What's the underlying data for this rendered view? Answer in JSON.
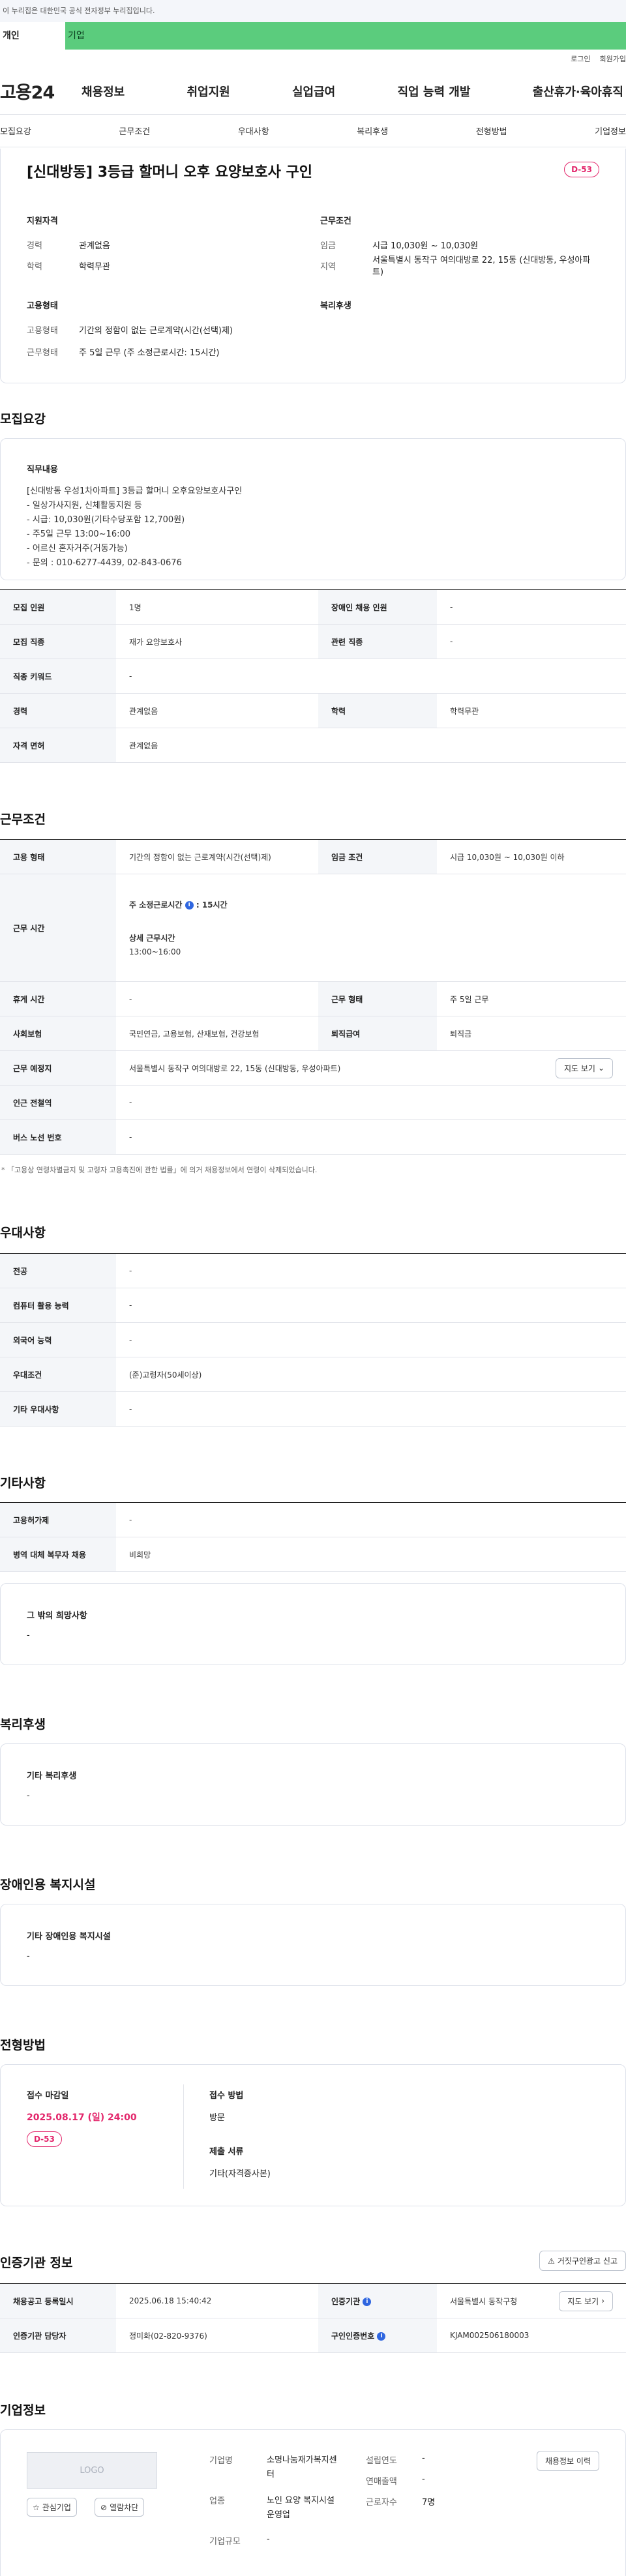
{
  "notice": "이 누리집은 대한민국 공식 전자정부 누리집입니다.",
  "tabs": {
    "personal": "개인",
    "company": "기업"
  },
  "util": {
    "login": "로그인",
    "join": "회원가입"
  },
  "logo": "고용24",
  "gnb": [
    "채용정보",
    "취업지원",
    "실업급여",
    "직업 능력 개발",
    "출산휴가·육아휴직"
  ],
  "subnav": [
    "모집요강",
    "근무조건",
    "우대사항",
    "복리후생",
    "전형방법",
    "기업정보"
  ],
  "summary": {
    "title": "[신대방동] 3등급 할머니 오후 요양보호사 구인",
    "dday": "D-53",
    "qual_title": "지원자격",
    "cond_title": "근무조건",
    "emp_title": "고용형태",
    "welfare_title": "복리후생",
    "career_k": "경력",
    "career_v": "관계없음",
    "edu_k": "학력",
    "edu_v": "학력무관",
    "wage_k": "임금",
    "wage_v": "시급 10,030원 ~ 10,030원",
    "region_k": "지역",
    "region_v": "서울특별시 동작구 여의대방로 22, 15동 (신대방동, 우성아파트)",
    "emptype_k": "고용형태",
    "emptype_v": "기간의 정함이 없는 근로계약(시간(선택)제)",
    "workshape_k": "근무형태",
    "workshape_v": "주 5일 근무 (주 소정근로시간: 15시간)"
  },
  "recruit": {
    "section": "모집요강",
    "job_title": "직무내용",
    "job_lines": [
      "[신대방동 우성1차아파트] 3등급 할머니 오후요양보호사구인",
      "- 일상가사지원, 신체활동지원 등",
      "- 시급: 10,030원(기타수당포함 12,700원)",
      "- 주5일 근무 13:00~16:00",
      "- 어르신 혼자거주(거동가능)",
      "- 문의 : 010-6277-4439, 02-843-0676"
    ],
    "rows": [
      [
        "모집 인원",
        "1명",
        "장애인 채용 인원",
        "-"
      ],
      [
        "모집 직종",
        "재가 요양보호사",
        "관련 직종",
        "-"
      ],
      [
        "직종 키워드",
        "-"
      ],
      [
        "경력",
        "관계없음",
        "학력",
        "학력무관"
      ],
      [
        "자격 면허",
        "관계없음"
      ]
    ]
  },
  "work": {
    "section": "근무조건",
    "emptype_k": "고용 형태",
    "emptype_v": "기간의 정함이 없는 근로계약(시간(선택)제)",
    "wage_k": "임금 조건",
    "wage_v": "시급 10,030원 ~ 10,030원 이하",
    "hours_k": "근무 시간",
    "hours_weekly_label": "주 소정근로시간",
    "hours_weekly_value": ": 15시간",
    "hours_detail_label": "상세 근무시간",
    "hours_detail_value": "13:00~16:00",
    "rest_k": "휴게 시간",
    "rest_v": "-",
    "shape_k": "근무 형태",
    "shape_v": "주 5일 근무",
    "insurance_k": "사회보험",
    "insurance_v": "국민연금, 고용보험, 산재보험, 건강보험",
    "retire_k": "퇴직급여",
    "retire_v": "퇴직금",
    "place_k": "근무 예정지",
    "place_v": "서울특별시 동작구 여의대방로 22, 15동 (신대방동, 우성아파트)",
    "map_btn": "지도 보기",
    "subway_k": "인근 전철역",
    "subway_v": "-",
    "bus_k": "버스 노선 번호",
    "bus_v": "-",
    "note": "* 「고용상 연령차별금지 및 고령자 고용촉진에 관한 법률」에 의거 채용정보에서 연령이 삭제되었습니다."
  },
  "pref": {
    "section": "우대사항",
    "rows": [
      [
        "전공",
        "-"
      ],
      [
        "컴퓨터 활용 능력",
        "-"
      ],
      [
        "외국어 능력",
        "-"
      ],
      [
        "우대조건",
        "(준)고령자(50세이상)"
      ],
      [
        "기타 우대사항",
        "-"
      ]
    ]
  },
  "etc": {
    "section": "기타사항",
    "rows": [
      [
        "고용허가제",
        "-"
      ],
      [
        "병역 대체 복무자 채용",
        "비희망"
      ]
    ],
    "wish_title": "그 밖의 희망사항",
    "wish_v": "-"
  },
  "welfare": {
    "section": "복리후생",
    "title": "기타 복리후생",
    "v": "-"
  },
  "facility": {
    "section": "장애인용 복지시설",
    "title": "기타 장애인용 복지시설",
    "v": "-"
  },
  "selection": {
    "section": "전형방법",
    "deadline_title": "접수 마감일",
    "deadline_v": "2025.08.17 (일) 24:00",
    "dday": "D-53",
    "method_title": "접수 방법",
    "method_v": "방문",
    "docs_title": "제출 서류",
    "docs_v": "기타(자격증사본)"
  },
  "cert": {
    "section": "인증기관 정보",
    "report_btn": "거짓구인광고 신고",
    "reg_k": "채용공고 등록일시",
    "reg_v": "2025.06.18 15:40:42",
    "org_k": "인증기관",
    "org_v": "서울특별시 동작구청",
    "map_btn": "지도 보기",
    "mgr_k": "인증기관 담당자",
    "mgr_v": "정미화(02-820-9376)",
    "code_k": "구인인증번호",
    "code_v": "KJAM002506180003"
  },
  "company": {
    "section": "기업정보",
    "logo_text": "LOGO",
    "fav_btn": "관심기업",
    "block_btn": "열람차단",
    "name_k": "기업명",
    "name_v": "소명나눔재가복지센터",
    "year_k": "설립연도",
    "year_v": "-",
    "sales_k": "연매출액",
    "sales_v": "-",
    "biz_k": "업종",
    "biz_v": "노인 요양 복지시설 운영업",
    "emp_k": "근로자수",
    "emp_v": "7명",
    "size_k": "기업규모",
    "size_v": "-",
    "history_btn": "채용정보 이력"
  },
  "colors": {
    "accent_green": "#5bcc7d",
    "dday_pink": "#e3266b",
    "info_blue": "#2f66e0"
  }
}
